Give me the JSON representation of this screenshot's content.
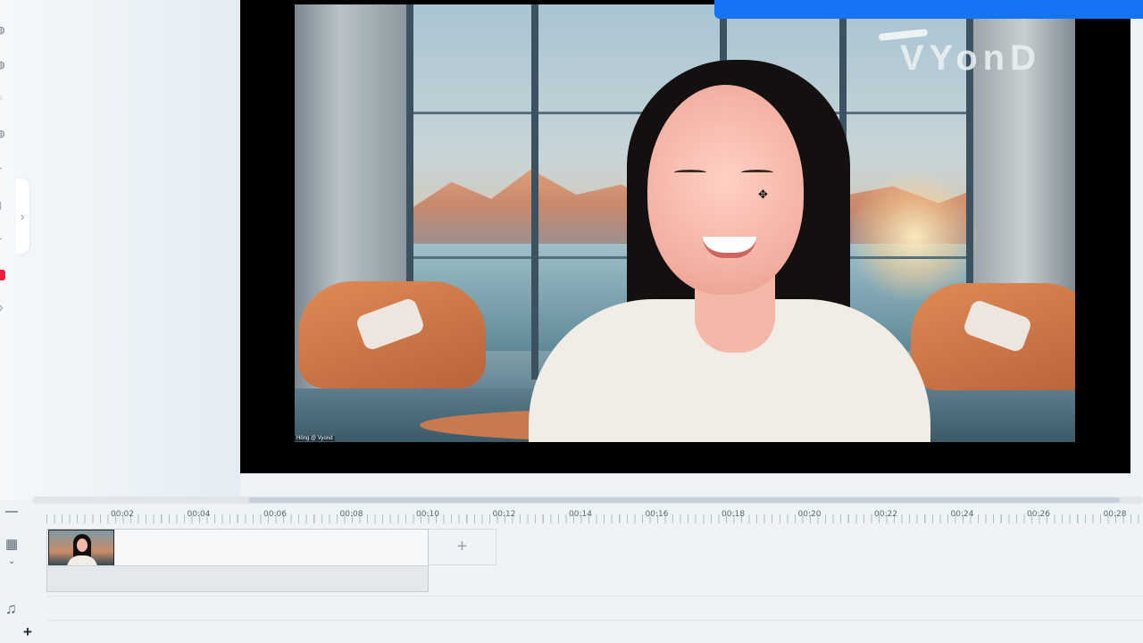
{
  "brand": {
    "watermark": "VYonD",
    "caption": "Hông @ Vyond"
  },
  "colors": {
    "accent": "#1673f5",
    "record": "#e5213b",
    "stage_bg": "#000000"
  },
  "left_rail": {
    "icons": [
      "scene-icon",
      "character-icon",
      "prop-icon",
      "text-icon",
      "chart-icon",
      "audio-icon",
      "effects-icon",
      "record-icon",
      "templates-icon"
    ]
  },
  "side_panel": {
    "toggle_icon": "›"
  },
  "stage": {
    "cursor": "✥"
  },
  "timeline": {
    "ticks": [
      "00:02",
      "00:04",
      "00:06",
      "00:08",
      "00:10",
      "00:12",
      "00:14",
      "00:16",
      "00:18",
      "00:20",
      "00:22",
      "00:24",
      "00:26",
      "00:28"
    ],
    "track_icon": "▦",
    "chevron": "⌄",
    "add_scene": "+",
    "audio_icon": "♫",
    "add_track": "+"
  }
}
